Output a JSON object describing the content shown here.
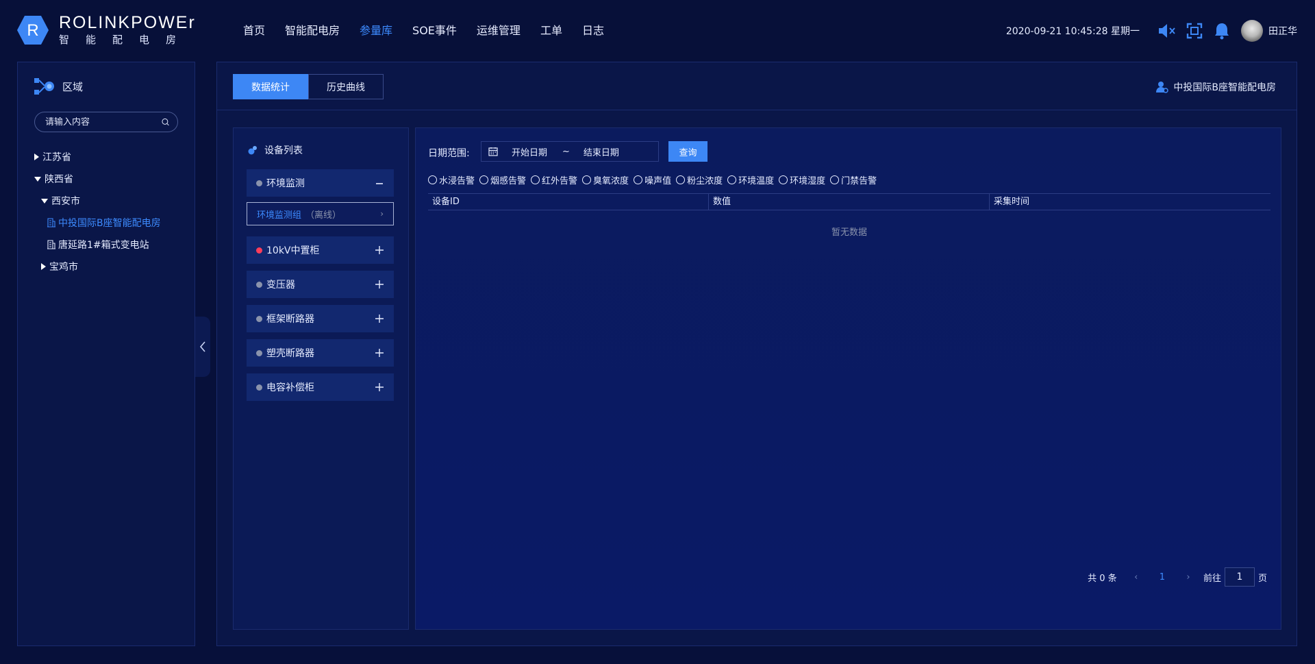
{
  "header": {
    "brand": "ROLINKPOWEr",
    "brand_sub": "智能配电房",
    "logo_letter": "R",
    "nav": [
      "首页",
      "智能配电房",
      "参量库",
      "SOE事件",
      "运维管理",
      "工单",
      "日志"
    ],
    "active_nav_index": 2,
    "datetime": "2020-09-21 10:45:28 星期一",
    "user_name": "田正华"
  },
  "sidebar": {
    "title": "区域",
    "search_placeholder": "请输入内容",
    "tree": [
      {
        "label": "江苏省",
        "level": 0,
        "type": "collapsed"
      },
      {
        "label": "陕西省",
        "level": 0,
        "type": "expanded"
      },
      {
        "label": "西安市",
        "level": 1,
        "type": "expanded"
      },
      {
        "label": "中投国际B座智能配电房",
        "level": 2,
        "type": "building",
        "active": true
      },
      {
        "label": "唐延路1#箱式变电站",
        "level": 2,
        "type": "building"
      },
      {
        "label": "宝鸡市",
        "level": 1,
        "type": "collapsed"
      }
    ]
  },
  "main": {
    "tabs": [
      "数据统计",
      "历史曲线"
    ],
    "active_tab": 0,
    "station_name": "中投国际B座智能配电房"
  },
  "device_panel": {
    "title": "设备列表",
    "items": [
      {
        "label": "环境监测",
        "status": "gray",
        "expanded": true
      },
      {
        "label": "10kV中置柜",
        "status": "red",
        "expanded": false
      },
      {
        "label": "变压器",
        "status": "gray",
        "expanded": false
      },
      {
        "label": "框架断路器",
        "status": "gray",
        "expanded": false
      },
      {
        "label": "塑壳断路器",
        "status": "gray",
        "expanded": false
      },
      {
        "label": "电容补偿柜",
        "status": "gray",
        "expanded": false
      }
    ],
    "sub_item": {
      "name": "环境监测组",
      "status": "（离线）"
    }
  },
  "data_panel": {
    "date_label": "日期范围:",
    "start_placeholder": "开始日期",
    "range_sep": "~",
    "end_placeholder": "结束日期",
    "query_label": "查询",
    "radio_options": [
      "水浸告警",
      "烟感告警",
      "红外告警",
      "臭氧浓度",
      "噪声值",
      "粉尘浓度",
      "环境温度",
      "环境湿度",
      "门禁告警"
    ],
    "columns": [
      "设备ID",
      "数值",
      "采集时间"
    ],
    "empty_text": "暂无数据",
    "pager": {
      "total": "共 0 条",
      "current_page": "1",
      "goto_label": "前往",
      "goto_value": "1",
      "page_suffix": "页"
    }
  },
  "colors": {
    "accent": "#3d87f5",
    "active_text": "#3d8bff",
    "background": "#07103a",
    "panel": "#0a1648",
    "alarm": "#ff3d5a"
  }
}
